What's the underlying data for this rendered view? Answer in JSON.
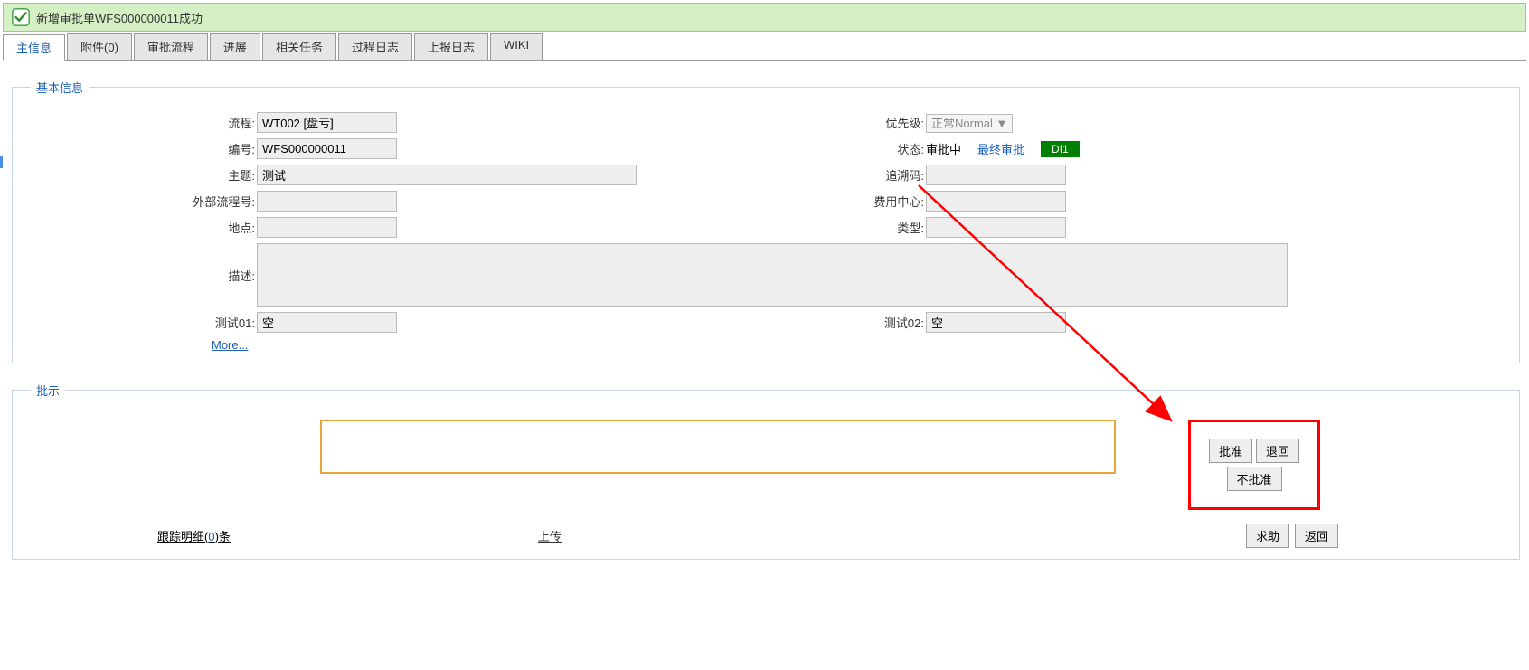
{
  "notification": "新增审批单WFS000000011成功",
  "tabs": [
    {
      "label": "主信息",
      "active": true
    },
    {
      "label": "附件(0)",
      "active": false
    },
    {
      "label": "审批流程",
      "active": false
    },
    {
      "label": "进展",
      "active": false
    },
    {
      "label": "相关任务",
      "active": false
    },
    {
      "label": "过程日志",
      "active": false
    },
    {
      "label": "上报日志",
      "active": false
    },
    {
      "label": "WIKI",
      "active": false
    }
  ],
  "section_basic_title": "基本信息",
  "section_approval_title": "批示",
  "fields": {
    "process_label": "流程:",
    "process_value": "WT002 [盘亏]",
    "priority_label": "优先级:",
    "priority_value": "正常Normal ▼",
    "number_label": "编号:",
    "number_value": "WFS000000011",
    "status_label": "状态:",
    "status_value": "审批中",
    "status_link": "最终审批",
    "status_badge": "DI1",
    "subject_label": "主题:",
    "subject_value": "测试",
    "trace_label": "追溯码:",
    "trace_value": "",
    "ext_process_label": "外部流程号:",
    "ext_process_value": "",
    "cost_center_label": "费用中心:",
    "cost_center_value": "",
    "location_label": "地点:",
    "location_value": "",
    "type_label": "类型:",
    "type_value": "",
    "description_label": "描述:",
    "description_value": "",
    "test01_label": "测试01:",
    "test01_value": "空",
    "test02_label": "测试02:",
    "test02_value": "空",
    "more": "More..."
  },
  "actions": {
    "approve": "批准",
    "return": "退回",
    "reject": "不批准",
    "help": "求助",
    "back": "返回"
  },
  "track_detail_prefix": "跟踪明细(",
  "track_detail_count": "0",
  "track_detail_suffix": ")条",
  "upload": "上传"
}
